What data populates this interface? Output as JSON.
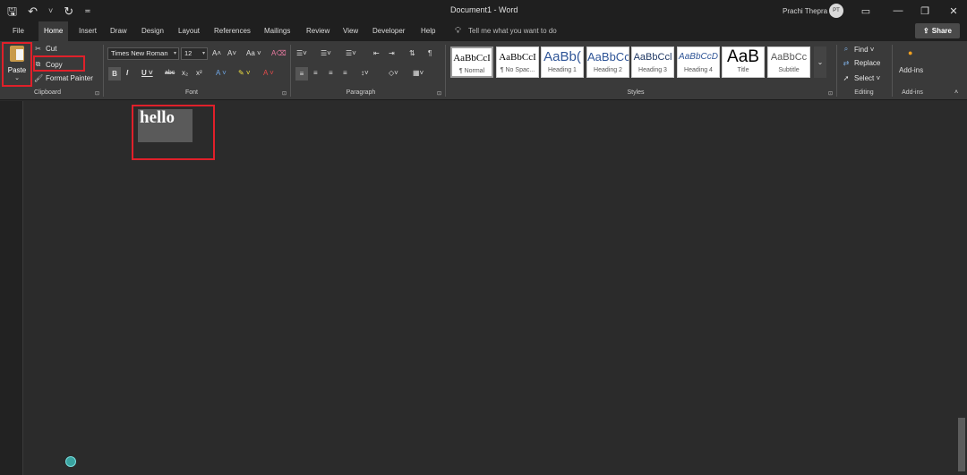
{
  "titlebar": {
    "doc_title": "Document1  -  Word",
    "user_name": "Prachi Thepra",
    "avatar_initials": "PT",
    "qat_save": "🖫",
    "qat_undo": "↶",
    "qat_undo_more": "˅",
    "qat_redo": "↻",
    "qat_customize": "≖",
    "ribbon_options": "▭",
    "minimize": "—",
    "restore": "❐",
    "close": "✕"
  },
  "tabs": [
    {
      "label": "File"
    },
    {
      "label": "Home"
    },
    {
      "label": "Insert"
    },
    {
      "label": "Draw"
    },
    {
      "label": "Design"
    },
    {
      "label": "Layout"
    },
    {
      "label": "References"
    },
    {
      "label": "Mailings"
    },
    {
      "label": "Review"
    },
    {
      "label": "View"
    },
    {
      "label": "Developer"
    },
    {
      "label": "Help"
    }
  ],
  "tellme": {
    "placeholder": "Tell me what you want to do"
  },
  "share": {
    "label": "Share"
  },
  "clipboard": {
    "paste": "Paste",
    "cut": "Cut",
    "copy": "Copy",
    "format_painter": "Format Painter",
    "group_label": "Clipboard"
  },
  "font": {
    "name": "Times New Roman",
    "size": "12",
    "group_label": "Font",
    "grow": "A˄",
    "shrink": "A˅",
    "case": "Aa ˅",
    "clear": "A⌫",
    "bold": "B",
    "italic": "I",
    "underline": "U ˅",
    "strike": "abc",
    "sub": "x₂",
    "sup": "x²",
    "effects": "A ˅",
    "highlight": "✎ ˅",
    "color": "A ˅"
  },
  "paragraph": {
    "group_label": "Paragraph"
  },
  "styles": {
    "group_label": "Styles",
    "tiles": [
      {
        "sample": "AaBbCcI",
        "name": "¶ Normal"
      },
      {
        "sample": "AaBbCcI",
        "name": "¶ No Spac..."
      },
      {
        "sample": "AaBb(",
        "name": "Heading 1"
      },
      {
        "sample": "AaBbCc",
        "name": "Heading 2"
      },
      {
        "sample": "AaBbCcl",
        "name": "Heading 3"
      },
      {
        "sample": "AaBbCcD",
        "name": "Heading 4"
      },
      {
        "sample": "AaB",
        "name": "Title"
      },
      {
        "sample": "AaBbCc",
        "name": "Subtitle"
      }
    ]
  },
  "editing": {
    "find": "Find ˅",
    "replace": "Replace",
    "select": "Select ˅",
    "group_label": "Editing"
  },
  "addins": {
    "label": "Add-ins",
    "group_label": "Add-ins"
  },
  "document": {
    "text": "hello"
  }
}
